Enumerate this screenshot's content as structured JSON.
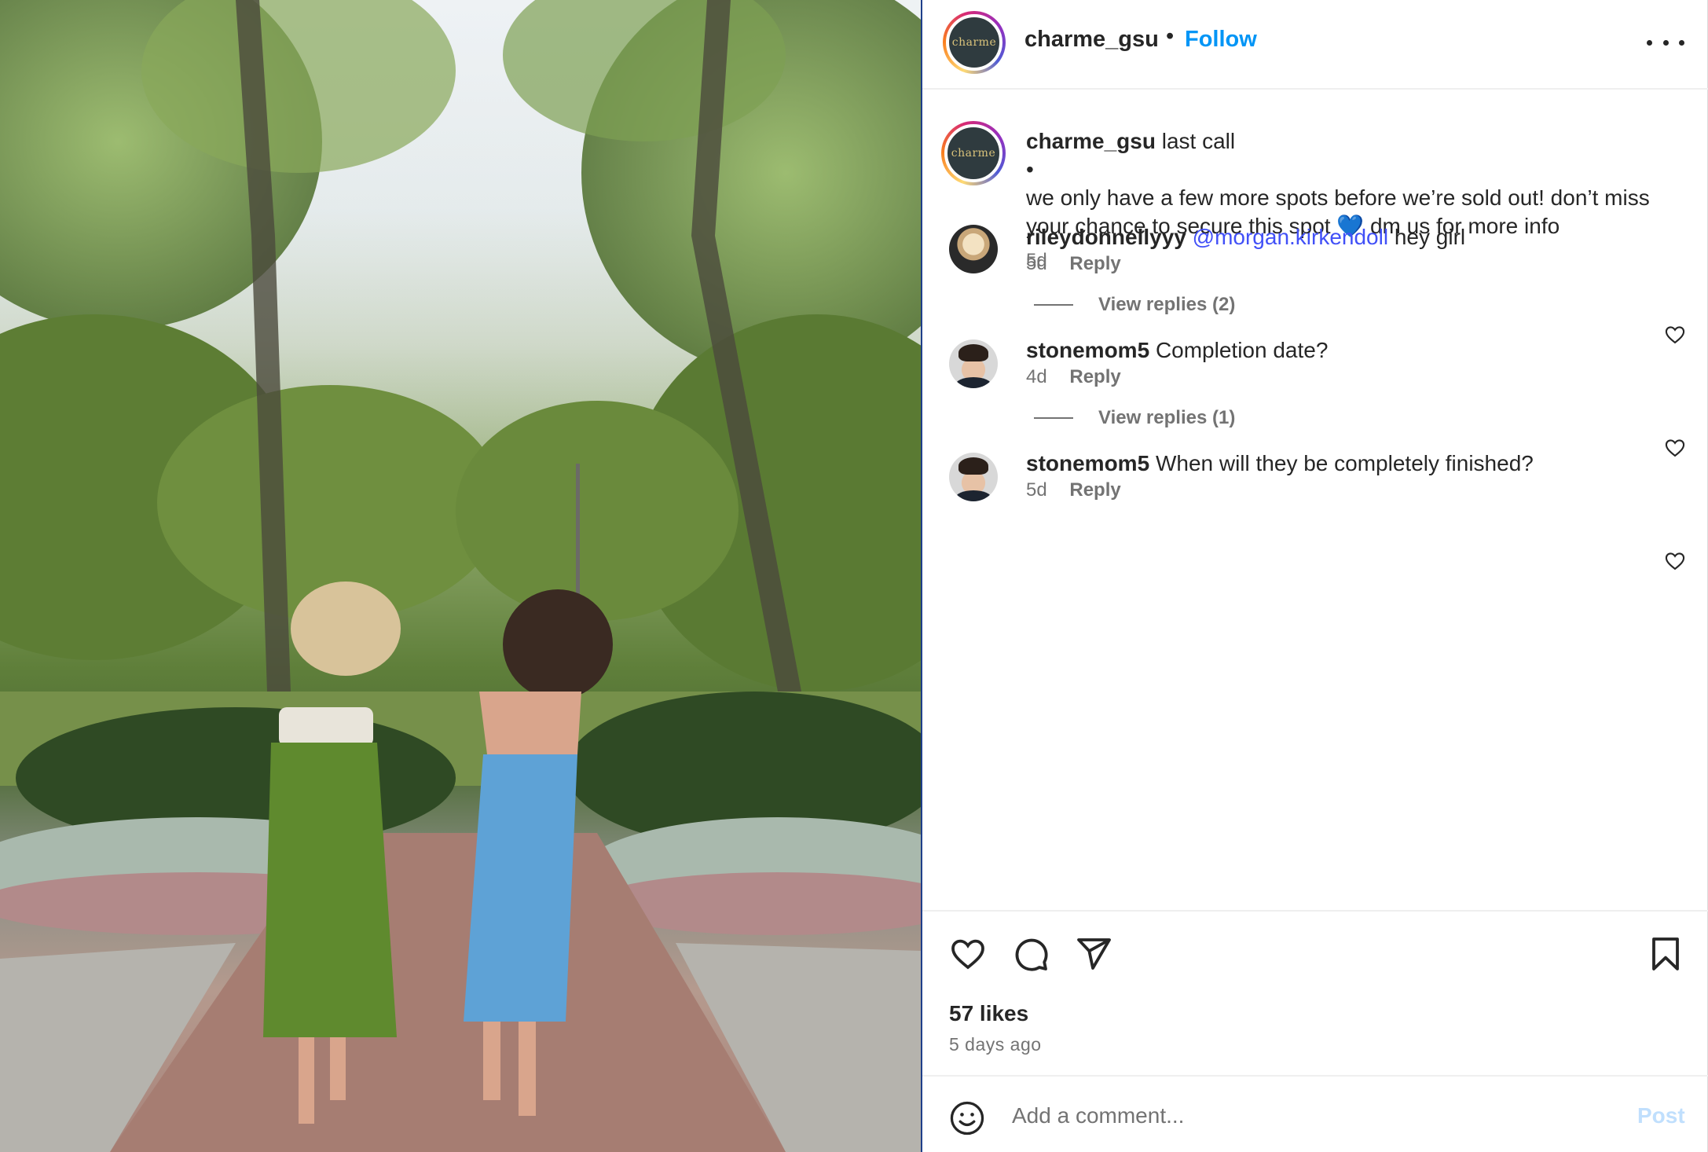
{
  "header": {
    "avatar_text": "charme",
    "username": "charme_gsu",
    "separator": "•",
    "follow_label": "Follow"
  },
  "caption": {
    "username": "charme_gsu",
    "line1": "last call",
    "bullet": "•",
    "body": "we only have a few more spots before we’re sold out! don’t miss your chance to secure this spot 💙 dm us for more info",
    "time": "5d"
  },
  "comments": [
    {
      "username": "rileydonnellyyy",
      "mention": "@morgan.kirkendoll",
      "text": "hey girl",
      "time": "5d",
      "reply_label": "Reply",
      "view_replies": "View replies (2)"
    },
    {
      "username": "stonemom5",
      "mention": "",
      "text": "Completion date?",
      "time": "4d",
      "reply_label": "Reply",
      "view_replies": "View replies (1)"
    },
    {
      "username": "stonemom5",
      "mention": "",
      "text": "When will they be completely finished?",
      "time": "5d",
      "reply_label": "Reply",
      "view_replies": ""
    }
  ],
  "actions": {
    "icons": [
      "heart-icon",
      "comment-icon",
      "share-icon",
      "bookmark-icon"
    ],
    "likes": "57 likes",
    "time_ago": "5 days ago"
  },
  "composer": {
    "emoji_icon": "smiley-icon",
    "placeholder": "Add a comment...",
    "post_label": "Post"
  },
  "colors": {
    "follow": "#0095f6",
    "mention": "#4150f7",
    "secondary_text": "#737373",
    "post_disabled": "#c0dffd"
  }
}
